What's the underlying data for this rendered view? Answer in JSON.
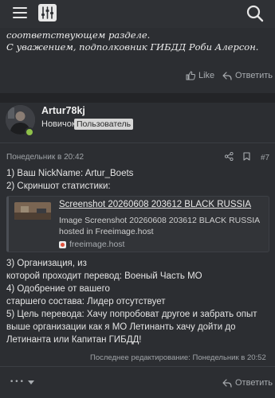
{
  "topbar": {
    "menu_icon": "hamburger-menu-icon",
    "filter_icon": "filter-sliders-icon",
    "search_icon": "search-icon"
  },
  "prev_post": {
    "line1": "соответствующем разделе.",
    "line2": "С уважением, подполковник ГИБДД Роби Алерсон.",
    "like_label": "Like",
    "reply_label": "Ответить"
  },
  "post": {
    "username": "Artur78kj",
    "rank": "Новичок",
    "group_badge": "Пользователь",
    "date": "Понедельник в 20:42",
    "number": "#7",
    "lines": [
      "1) Ваш NickName: Artur_Boets",
      "2) Скриншот статистики:"
    ],
    "embed": {
      "title": "Screenshot 20260608 203612 BLACK RUSSIA",
      "desc": "Image Screenshot 20260608 203612 BLACK RUSSIA hosted in Freeimage.host",
      "site": "freeimage.host"
    },
    "lines_after": [
      "3) Организация, из",
      "которой проходит перевод: Военый Часть МО",
      "4) Одобрение от вашего",
      "старшего состава: Лидер отсутствует",
      "5) Цель перевода: Хачу попробоват другое и забрать опыт выше организации как я МО Летинанть хачу дойти до Летинанта или Капитан ГИБДД!"
    ],
    "edited": "Последнее редактирование: Понедельник в 20:52"
  },
  "footer": {
    "more_label": "•••",
    "reply_label": "Ответить"
  },
  "colors": {
    "background": "#27292c",
    "panel": "#2c2e32",
    "online": "#8fc14a",
    "muted": "#a8acb0"
  }
}
